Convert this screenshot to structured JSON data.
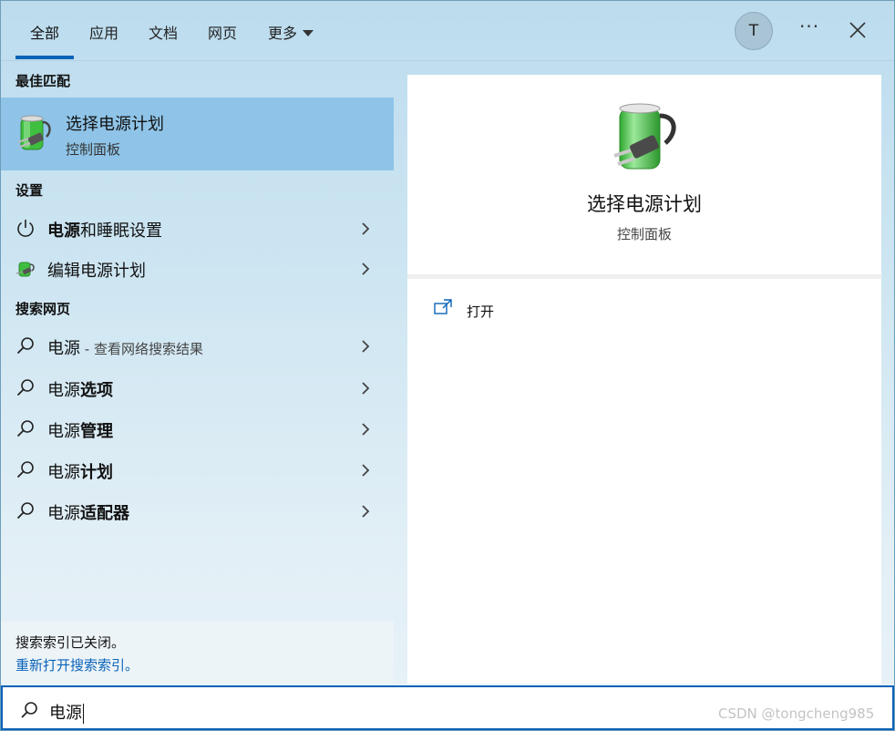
{
  "tabs": [
    {
      "label": "全部"
    },
    {
      "label": "应用"
    },
    {
      "label": "文档"
    },
    {
      "label": "网页"
    },
    {
      "label": "更多"
    }
  ],
  "account": {
    "initial": "T"
  },
  "menu": {
    "more_label": "···"
  },
  "sections": {
    "best_match": "最佳匹配",
    "settings": "设置",
    "web": "搜索网页"
  },
  "best_match": {
    "title": "选择电源计划",
    "subtitle": "控制面板",
    "icon": "battery-plug-icon"
  },
  "settings_items": [
    {
      "bold": "电源",
      "rest": "和睡眠设置",
      "icon": "power-icon"
    },
    {
      "bold": "",
      "rest": "编辑电源计划",
      "icon": "battery-plug-icon"
    }
  ],
  "web_items": [
    {
      "plain": "电源",
      "bold": "",
      "suffix": " - 查看网络搜索结果"
    },
    {
      "plain": "电源",
      "bold": "选项",
      "suffix": ""
    },
    {
      "plain": "电源",
      "bold": "管理",
      "suffix": ""
    },
    {
      "plain": "电源",
      "bold": "计划",
      "suffix": ""
    },
    {
      "plain": "电源",
      "bold": "适配器",
      "suffix": ""
    }
  ],
  "index_notice": {
    "message": "搜索索引已关闭。",
    "link": "重新打开搜索索引。"
  },
  "detail": {
    "title": "选择电源计划",
    "subtitle": "控制面板",
    "open_label": "打开"
  },
  "search": {
    "query": "电源"
  },
  "watermark": "CSDN @tongcheng985",
  "colors": {
    "accent": "#0a63b8",
    "selected": "#8fc4e8",
    "battery_green": "#3fbf3f"
  }
}
